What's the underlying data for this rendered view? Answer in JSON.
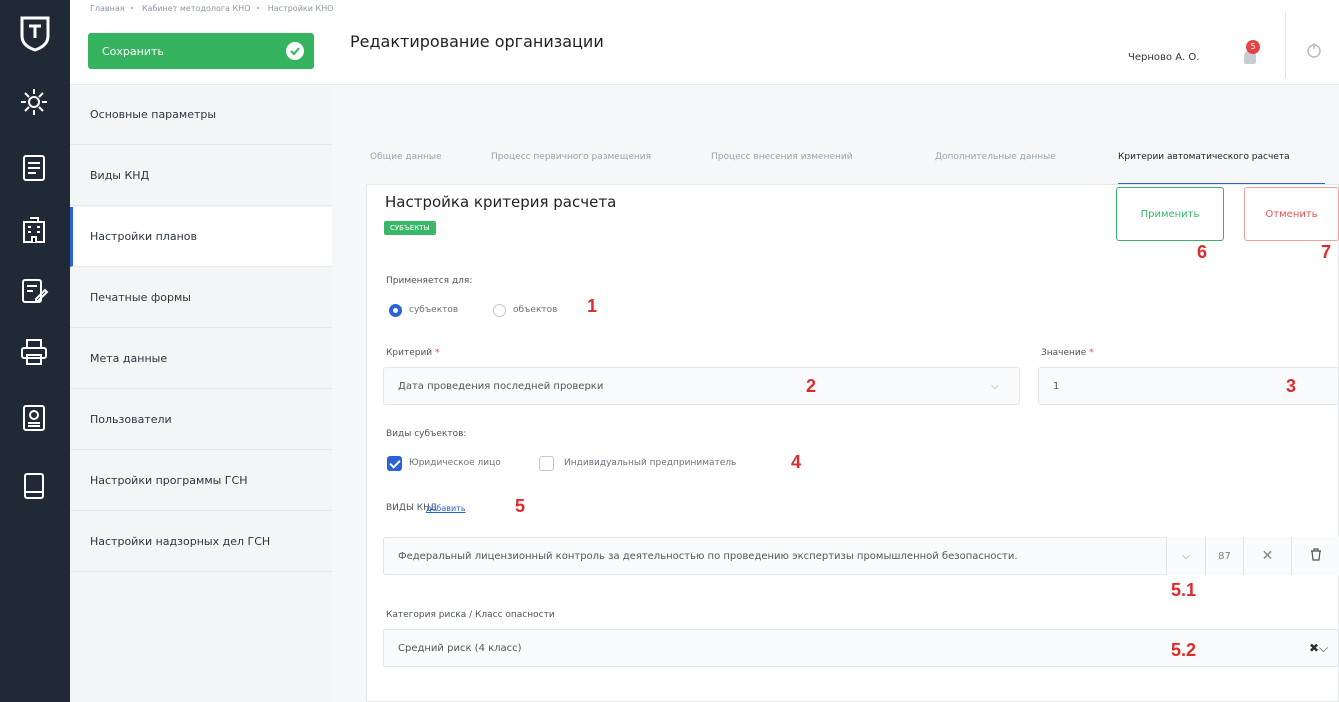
{
  "breadcrumbs": [
    "Главная",
    "Кабинет методолога КНО",
    "Настройки КНО"
  ],
  "toolbar": {
    "save_label": "Сохранить"
  },
  "page_title": "Редактирование организации",
  "user": {
    "name": "Черново А. О.",
    "notifications": "5"
  },
  "rail_icons": [
    "logo-shield-icon",
    "gear-icon",
    "document-icon",
    "building-icon",
    "edit-form-icon",
    "printer-icon",
    "report-icon",
    "book-icon"
  ],
  "sidebar": {
    "items": [
      {
        "label": "Основные параметры"
      },
      {
        "label": "Виды КНД"
      },
      {
        "label": "Настройки планов"
      },
      {
        "label": "Печатные формы"
      },
      {
        "label": "Мета данные"
      },
      {
        "label": "Пользователи"
      },
      {
        "label": "Настройки программы ГСН"
      },
      {
        "label": "Настройки надзорных дел ГСН"
      }
    ]
  },
  "tabs": [
    {
      "label": "Общие данные"
    },
    {
      "label": "Процесс первичного размещения"
    },
    {
      "label": "Процесс внесения изменений"
    },
    {
      "label": "Дополнительные данные"
    },
    {
      "label": "Критерии автоматического расчета"
    }
  ],
  "card": {
    "title": "Настройка критерия расчета",
    "tag": "СУБЪЕКТЫ",
    "apply_label": "Применить",
    "cancel_label": "Отменить",
    "applies_for_label": "Применяется для:",
    "radio_subjects": "субъектов",
    "radio_objects": "объектов",
    "criterion_label": "Критерий",
    "criterion_value": "Дата проведения последней проверки",
    "value_label": "Значение",
    "value_value": "1",
    "subject_types_label": "Виды субъектов:",
    "check_legal": "Юридическое лицо",
    "check_ip": "Индивидуальный предприниматель",
    "knd_label": "ВИДЫ КНД",
    "knd_add_link": "добавить",
    "knd_value": "Федеральный лицензионный контроль за деятельностью по проведению экспертизы промышленной безопасности.",
    "knd_code": "87",
    "risk_label": "Категория риска / Класс опасности",
    "risk_value": "Средний риск (4 класс)"
  },
  "annotations": [
    "1",
    "2",
    "3",
    "4",
    "5",
    "5.1",
    "5.2",
    "6",
    "7"
  ],
  "colors": {
    "accent": "#2a63d6",
    "success": "#35b35e",
    "danger": "#e64444",
    "rail": "#1f2a36"
  }
}
